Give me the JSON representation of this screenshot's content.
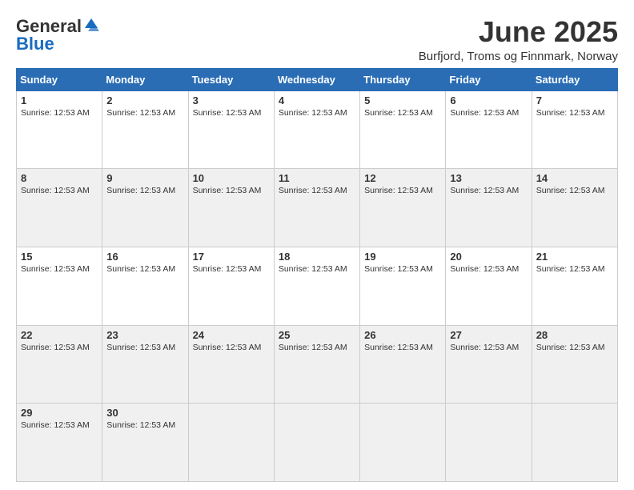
{
  "header": {
    "logo": {
      "general": "General",
      "blue": "Blue",
      "tagline": "GeneralBlue"
    },
    "title": "June 2025",
    "location": "Burfjord, Troms og Finnmark, Norway"
  },
  "weekdays": [
    "Sunday",
    "Monday",
    "Tuesday",
    "Wednesday",
    "Thursday",
    "Friday",
    "Saturday"
  ],
  "sunrise_label": "Sunrise:",
  "sunrise_time": "12:53 AM",
  "weeks": [
    {
      "days": [
        {
          "num": "1",
          "sunrise": "Sunrise: 12:53 AM"
        },
        {
          "num": "2",
          "sunrise": "Sunrise: 12:53 AM"
        },
        {
          "num": "3",
          "sunrise": "Sunrise: 12:53 AM"
        },
        {
          "num": "4",
          "sunrise": "Sunrise: 12:53 AM"
        },
        {
          "num": "5",
          "sunrise": "Sunrise: 12:53 AM"
        },
        {
          "num": "6",
          "sunrise": "Sunrise: 12:53 AM"
        },
        {
          "num": "7",
          "sunrise": "Sunrise: 12:53 AM"
        }
      ]
    },
    {
      "days": [
        {
          "num": "8",
          "sunrise": "Sunrise: 12:53 AM"
        },
        {
          "num": "9",
          "sunrise": "Sunrise: 12:53 AM"
        },
        {
          "num": "10",
          "sunrise": "Sunrise: 12:53 AM"
        },
        {
          "num": "11",
          "sunrise": "Sunrise: 12:53 AM"
        },
        {
          "num": "12",
          "sunrise": "Sunrise: 12:53 AM"
        },
        {
          "num": "13",
          "sunrise": "Sunrise: 12:53 AM"
        },
        {
          "num": "14",
          "sunrise": "Sunrise: 12:53 AM"
        }
      ]
    },
    {
      "days": [
        {
          "num": "15",
          "sunrise": "Sunrise: 12:53 AM"
        },
        {
          "num": "16",
          "sunrise": "Sunrise: 12:53 AM"
        },
        {
          "num": "17",
          "sunrise": "Sunrise: 12:53 AM"
        },
        {
          "num": "18",
          "sunrise": "Sunrise: 12:53 AM"
        },
        {
          "num": "19",
          "sunrise": "Sunrise: 12:53 AM"
        },
        {
          "num": "20",
          "sunrise": "Sunrise: 12:53 AM"
        },
        {
          "num": "21",
          "sunrise": "Sunrise: 12:53 AM"
        }
      ]
    },
    {
      "days": [
        {
          "num": "22",
          "sunrise": "Sunrise: 12:53 AM"
        },
        {
          "num": "23",
          "sunrise": "Sunrise: 12:53 AM"
        },
        {
          "num": "24",
          "sunrise": "Sunrise: 12:53 AM"
        },
        {
          "num": "25",
          "sunrise": "Sunrise: 12:53 AM"
        },
        {
          "num": "26",
          "sunrise": "Sunrise: 12:53 AM"
        },
        {
          "num": "27",
          "sunrise": "Sunrise: 12:53 AM"
        },
        {
          "num": "28",
          "sunrise": "Sunrise: 12:53 AM"
        }
      ]
    },
    {
      "days": [
        {
          "num": "29",
          "sunrise": "Sunrise: 12:53 AM"
        },
        {
          "num": "30",
          "sunrise": "Sunrise: 12:53 AM"
        },
        {
          "num": "",
          "sunrise": ""
        },
        {
          "num": "",
          "sunrise": ""
        },
        {
          "num": "",
          "sunrise": ""
        },
        {
          "num": "",
          "sunrise": ""
        },
        {
          "num": "",
          "sunrise": ""
        }
      ]
    }
  ]
}
